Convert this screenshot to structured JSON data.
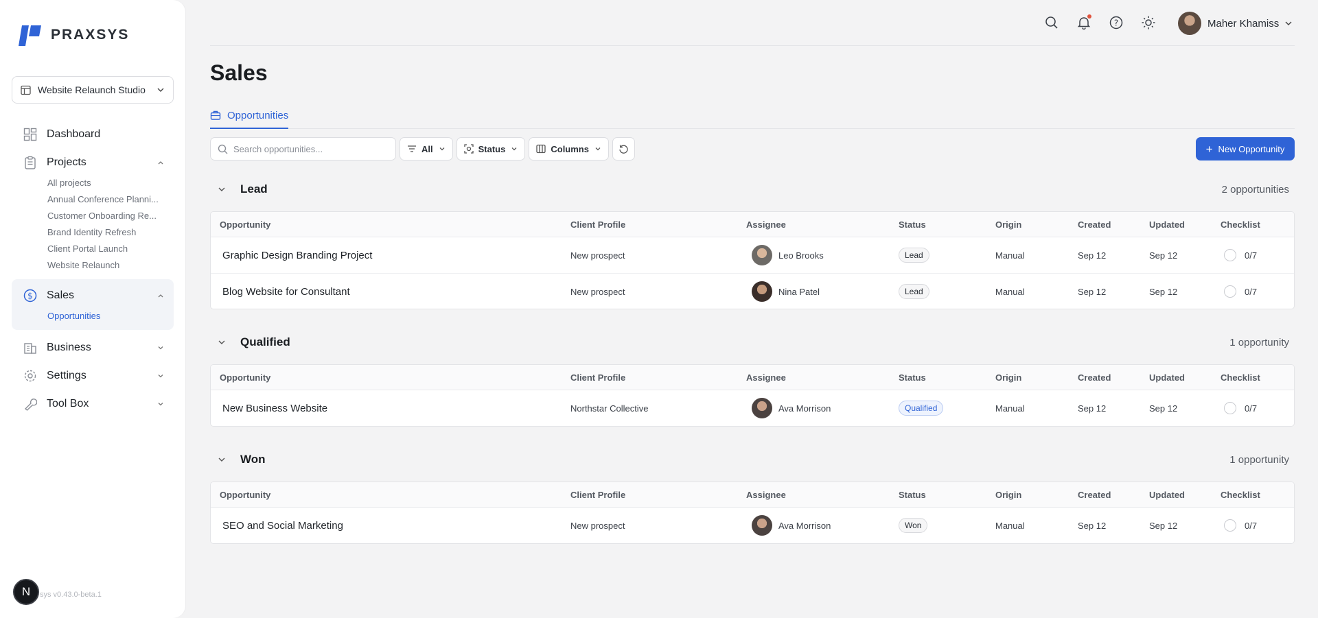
{
  "app": {
    "name": "PRAXSYS",
    "version_text": "sys v0.43.0-beta.1",
    "dev_badge": "N"
  },
  "colors": {
    "accent": "#2f63d6",
    "logo": "#2f63d6",
    "notification": "#e0533d"
  },
  "workspace": {
    "name": "Website Relaunch Studio"
  },
  "sidebar": {
    "dashboard": "Dashboard",
    "projects": {
      "label": "Projects",
      "items": [
        "All projects",
        "Annual Conference Planni...",
        "Customer Onboarding Re...",
        "Brand Identity Refresh",
        "Client Portal Launch",
        "Website Relaunch"
      ]
    },
    "sales": {
      "label": "Sales",
      "items": [
        "Opportunities"
      ]
    },
    "business": "Business",
    "settings": "Settings",
    "toolbox": "Tool Box"
  },
  "header": {
    "user_name": "Maher Khamiss"
  },
  "page": {
    "title": "Sales",
    "tab": "Opportunities"
  },
  "toolbar": {
    "search_placeholder": "Search opportunities...",
    "filter_label": "All",
    "status_label": "Status",
    "columns_label": "Columns",
    "new_button": "New Opportunity"
  },
  "columns": [
    "Opportunity",
    "Client Profile",
    "Assignee",
    "Status",
    "Origin",
    "Created",
    "Updated",
    "Checklist"
  ],
  "groups": [
    {
      "name": "Lead",
      "count": "2 opportunities",
      "rows": [
        {
          "opportunity": "Graphic Design Branding Project",
          "client": "New prospect",
          "assignee": "Leo Brooks",
          "status": "Lead",
          "origin": "Manual",
          "created": "Sep 12",
          "updated": "Sep 12",
          "checklist": "0/7"
        },
        {
          "opportunity": "Blog Website for Consultant",
          "client": "New prospect",
          "assignee": "Nina Patel",
          "status": "Lead",
          "origin": "Manual",
          "created": "Sep 12",
          "updated": "Sep 12",
          "checklist": "0/7"
        }
      ]
    },
    {
      "name": "Qualified",
      "count": "1 opportunity",
      "rows": [
        {
          "opportunity": "New Business Website",
          "client": "Northstar Collective",
          "assignee": "Ava Morrison",
          "status": "Qualified",
          "origin": "Manual",
          "created": "Sep 12",
          "updated": "Sep 12",
          "checklist": "0/7"
        }
      ]
    },
    {
      "name": "Won",
      "count": "1 opportunity",
      "rows": [
        {
          "opportunity": "SEO and Social Marketing",
          "client": "New prospect",
          "assignee": "Ava Morrison",
          "status": "Won",
          "origin": "Manual",
          "created": "Sep 12",
          "updated": "Sep 12",
          "checklist": "0/7"
        }
      ]
    }
  ]
}
